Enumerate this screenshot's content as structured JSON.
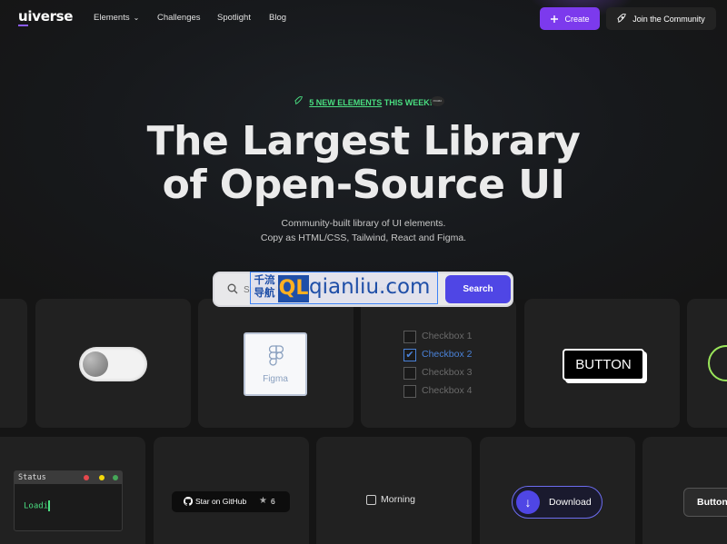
{
  "nav": {
    "logo_ui": "ui",
    "logo_verse": "verse",
    "items": [
      {
        "label": "Elements"
      },
      {
        "label": "Challenges"
      },
      {
        "label": "Spotlight"
      },
      {
        "label": "Blog"
      }
    ],
    "create_label": "Create",
    "community_label": "Join the Community"
  },
  "hero": {
    "badge_count": "5 NEW ELEMENTS",
    "badge_rest": " THIS WEEK!",
    "avatar_text": "FIGMA",
    "title_line1": "The Largest Library",
    "title_line2": "of Open-Source UI",
    "subtitle_line1": "Community-built library of UI elements.",
    "subtitle_line2": "Copy as HTML/CSS, Tailwind, React and Figma."
  },
  "search": {
    "placeholder": "Search for components, styles, creators...",
    "button_label": "Search"
  },
  "watermark": {
    "cn_text": "千流导航",
    "ql": "QL",
    "site": "qianliu.com"
  },
  "cards_row1": {
    "figma_label": "Figma",
    "checkboxes": [
      {
        "label": "Checkbox 1",
        "checked": false
      },
      {
        "label": "Checkbox 2",
        "checked": true
      },
      {
        "label": "Checkbox 3",
        "checked": false
      },
      {
        "label": "Checkbox 4",
        "checked": false
      }
    ],
    "check_mark": "✔",
    "button_label": "BUTTON"
  },
  "cards_row2": {
    "terminal_title": "Status",
    "terminal_text": "Loadi",
    "github_label": "Star on GitHub",
    "github_stars": "6",
    "morning_label": "Morning",
    "download_label": "Download",
    "dark_button_label": "Button"
  },
  "colors": {
    "accent": "#7c3aed",
    "search_button": "#4f46e5",
    "badge_green": "#4ade80"
  }
}
